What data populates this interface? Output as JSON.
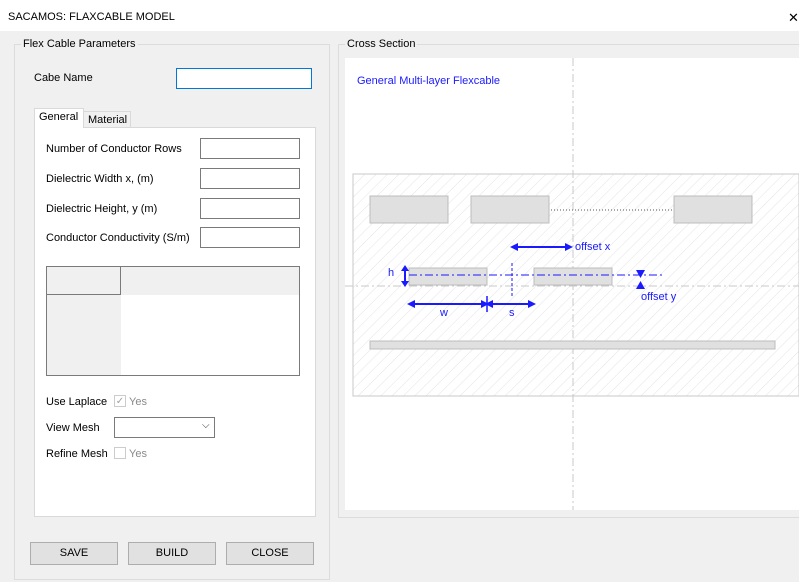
{
  "window": {
    "title": "SACAMOS: FLAXCABLE MODEL",
    "close_glyph": "✕"
  },
  "params_group": {
    "title": "Flex Cable Parameters"
  },
  "cable_name": {
    "label": "Cabe Name",
    "value": ""
  },
  "tabs": [
    {
      "label": "General"
    },
    {
      "label": "Material"
    }
  ],
  "fields": [
    {
      "label": "Number of Conductor Rows",
      "value": ""
    },
    {
      "label": "Dielectric Width x, (m)",
      "value": ""
    },
    {
      "label": "Dielectric Height, y (m)",
      "value": ""
    },
    {
      "label": "Conductor Conductivity (S/m)",
      "value": ""
    }
  ],
  "options": {
    "use_laplace": {
      "label": "Use Laplace",
      "check_label": "Yes",
      "checked": true
    },
    "view_mesh": {
      "label": "View Mesh",
      "value": ""
    },
    "refine_mesh": {
      "label": "Refine Mesh",
      "check_label": "Yes",
      "checked": false
    }
  },
  "buttons": {
    "save": "SAVE",
    "build": "BUILD",
    "close": "CLOSE"
  },
  "cross_section": {
    "title": "Cross Section",
    "caption": "General Multi-layer Flexcable",
    "labels": {
      "offset_x": "offset x",
      "offset_y": "offset y",
      "h": "h",
      "w": "w",
      "s": "s"
    }
  },
  "colors": {
    "accent": "#1a1aff",
    "focus": "#0078d7"
  }
}
